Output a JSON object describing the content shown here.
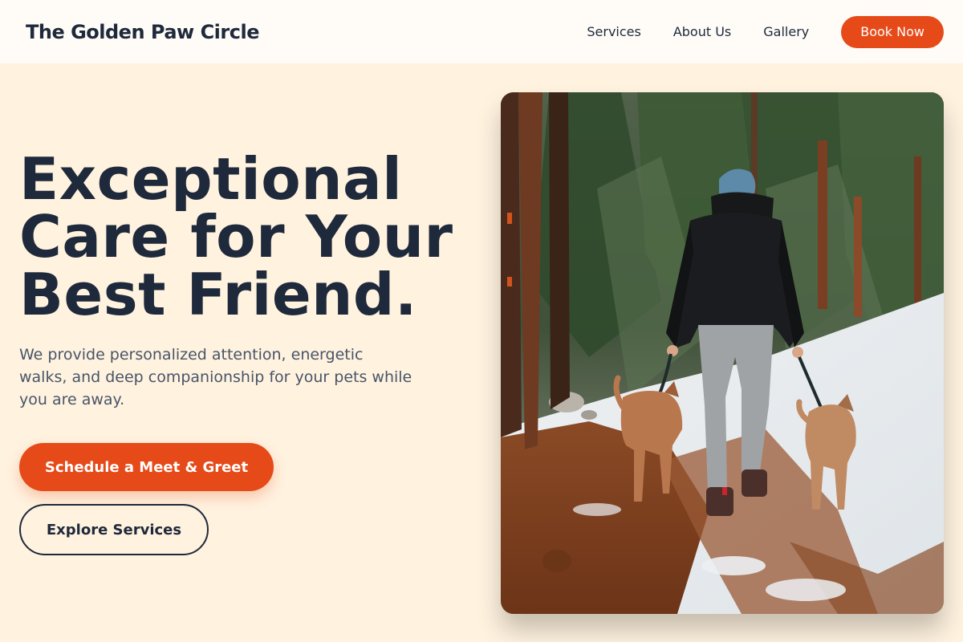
{
  "header": {
    "brand": "The Golden Paw Circle",
    "nav": [
      {
        "label": "Services"
      },
      {
        "label": "About Us"
      },
      {
        "label": "Gallery"
      }
    ],
    "cta_label": "Book Now"
  },
  "hero": {
    "title_lines": [
      "Exceptional",
      "Care for Your",
      "Best Friend."
    ],
    "subtitle": "We provide personalized attention, energetic walks, and deep companionship for your pets while you are away.",
    "primary_button": "Schedule a Meet & Greet",
    "secondary_button": "Explore Services"
  },
  "colors": {
    "accent": "#e64a19",
    "page_background": "#fff2df",
    "header_background": "#fffcf8",
    "text_dark": "#1e293b",
    "text_muted": "#475569"
  }
}
